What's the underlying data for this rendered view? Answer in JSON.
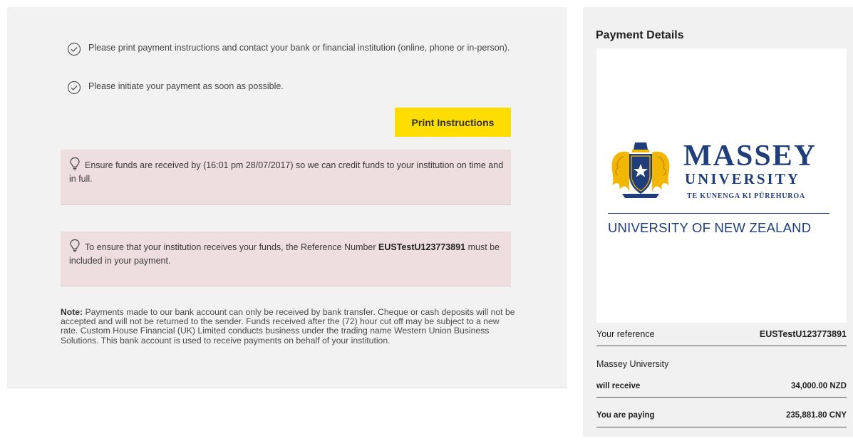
{
  "steps": [
    "Please print payment instructions and contact your bank or financial institution (online, phone or in-person).",
    "Please initiate your payment as soon as possible."
  ],
  "print_button_label": "Print Instructions",
  "alerts": {
    "deadline": "Ensure funds are received by (16:01 pm 28/07/2017) so we can credit funds to your institution on time and in full.",
    "reference_before": "To ensure that your institution receives your funds, the Reference Number ",
    "reference_number": "EUSTestU123773891",
    "reference_after": " must be included in your payment."
  },
  "note": {
    "label": "Note:",
    "text": " Payments made to our bank account can only be received by bank transfer. Cheque or cash deposits will not be accepted and will not be returned to the sender. Funds received after the (72) hour cut off may be subject to a new rate. Custom House Financial (UK) Limited conducts business under the trading name Western Union Business Solutions. This bank account is used to receive payments on behalf of your institution."
  },
  "payment_details": {
    "title": "Payment Details",
    "logo": {
      "name": "MASSEY",
      "subtitle": "UNIVERSITY",
      "maori": "TE KUNENGA KI PŪREHUROA",
      "tagline": "UNIVERSITY OF NEW ZEALAND"
    },
    "reference_label": "Your reference",
    "reference_value": "EUSTestU123773891",
    "recipient": "Massey University",
    "receive_label": "will receive",
    "receive_value": "34,000.00 NZD",
    "paying_label": "You are paying",
    "paying_value": "235,881.80 CNY"
  },
  "colors": {
    "button": "#ffdd00",
    "alert_bg": "#efdedf",
    "brand_blue": "#1f3e7a",
    "brand_gold": "#f2b705"
  },
  "icons": {
    "step": "check-circle-icon",
    "alert": "lightbulb-icon",
    "logo": "massey-crest-icon"
  }
}
